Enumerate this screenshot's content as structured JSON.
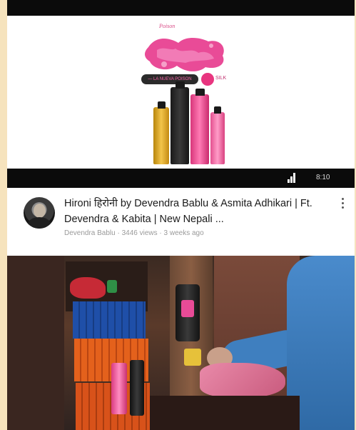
{
  "video1": {
    "ad_brand_text": "Poison",
    "banner_text": "— LA NUEVA POISON",
    "pill_word": "SILK",
    "time": "8:10",
    "signal_icon": "signal-bars-icon"
  },
  "video_info": {
    "title": "Hironi हिरोनी by Devendra Bablu & Asmita Adhikari | Ft. Devendra & Kabita | New Nepali ...",
    "meta": "Devendra Bablu · 3446 views · 3 weeks ago",
    "more_icon": "more-vert-icon",
    "avatar_icon": "channel-avatar"
  },
  "colors": {
    "background": "#f6e3bd",
    "accent_pink": "#e8357f",
    "text_primary": "#1a1a1a",
    "text_secondary": "#9a9a9a"
  }
}
